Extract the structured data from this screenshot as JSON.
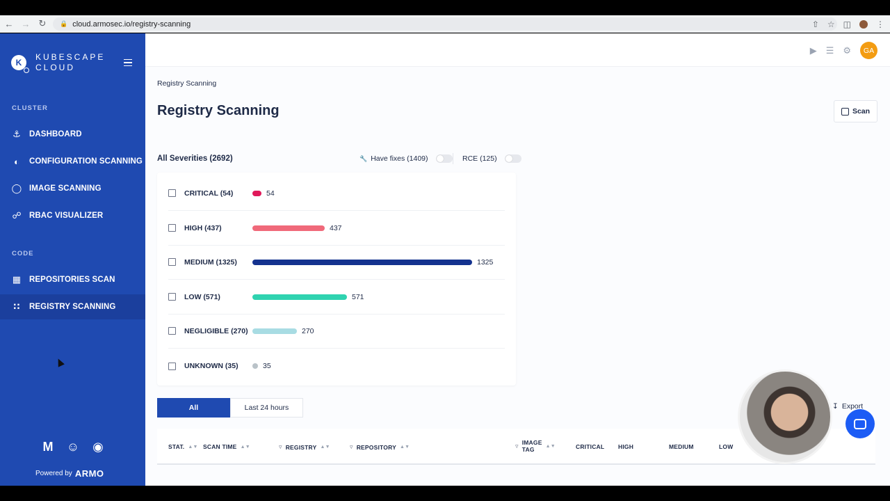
{
  "browser": {
    "url": "cloud.armosec.io/registry-scanning"
  },
  "sidebar": {
    "brand_line1": "KUBESCAPE",
    "brand_line2": "CLOUD",
    "brand_logo_letter": "K",
    "section_cluster": "CLUSTER",
    "section_code": "CODE",
    "items": [
      {
        "label": "DASHBOARD",
        "icon": "anchor-icon"
      },
      {
        "label": "CONFIGURATION SCANNING",
        "icon": "config-scan-icon"
      },
      {
        "label": "IMAGE SCANNING",
        "icon": "image-scan-icon"
      },
      {
        "label": "RBAC VISUALIZER",
        "icon": "rbac-icon"
      },
      {
        "label": "REPOSITORIES SCAN",
        "icon": "repo-scan-icon"
      },
      {
        "label": "REGISTRY SCANNING",
        "icon": "grid-icon"
      }
    ],
    "active_item": "REGISTRY SCANNING",
    "powered_by": "Powered by",
    "powered_brand": "ARMO",
    "social": [
      "gmail-icon",
      "discord-icon",
      "github-icon"
    ]
  },
  "header": {
    "user_initials": "GA",
    "icons": [
      "play-icon",
      "layers-icon",
      "gear-icon"
    ]
  },
  "main": {
    "breadcrumb": "Registry Scanning",
    "title": "Registry Scanning",
    "scan_label": "Scan",
    "all_severities": "All Severities (2692)",
    "have_fixes": "Have fixes (1409)",
    "rce": "RCE (125)",
    "severities": [
      {
        "label": "CRITICAL (54)",
        "count": "54",
        "value": 54,
        "color": "#e0195a"
      },
      {
        "label": "HIGH (437)",
        "count": "437",
        "value": 437,
        "color": "#f0697a"
      },
      {
        "label": "MEDIUM (1325)",
        "count": "1325",
        "value": 1325,
        "color": "#14328f"
      },
      {
        "label": "LOW (571)",
        "count": "571",
        "value": 571,
        "color": "#2fd3b0"
      },
      {
        "label": "NEGLIGIBLE (270)",
        "count": "270",
        "value": 270,
        "color": "#a8dce3"
      },
      {
        "label": "UNKNOWN (35)",
        "count": "35",
        "value": 35,
        "color": "#b9c2c8"
      }
    ],
    "tabs": [
      {
        "label": "All"
      },
      {
        "label": "Last 24 hours"
      }
    ],
    "export_label": "Export",
    "table_headers": {
      "status": "STAT.",
      "scan_time": "SCAN TIME",
      "registry": "REGISTRY",
      "repository": "REPOSITORY",
      "image_tag_1": "IMAGE",
      "image_tag_2": "TAG",
      "critical": "CRITICAL",
      "high": "HIGH",
      "medium": "MEDIUM",
      "low": "LOW"
    }
  }
}
